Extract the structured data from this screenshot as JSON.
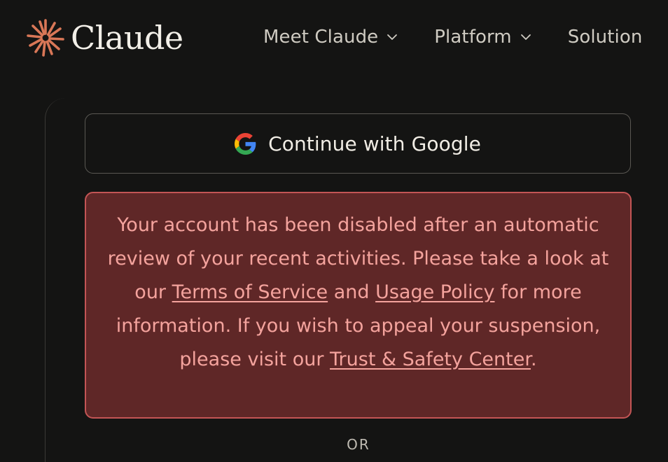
{
  "brand": {
    "name": "Claude",
    "accent_color": "#d97757"
  },
  "nav": {
    "items": [
      {
        "label": "Meet Claude"
      },
      {
        "label": "Platform"
      },
      {
        "label": "Solution"
      }
    ]
  },
  "login": {
    "google_button_label": "Continue with Google",
    "separator": "OR"
  },
  "alert": {
    "intro": "Your account has been disabled after an automatic review of your recent activities. Please take a look at our ",
    "terms_link": "Terms of Service",
    "and_text": " and ",
    "usage_link": "Usage Policy",
    "middle": " for more information. If you wish to appeal your suspension, please visit our ",
    "trust_link": "Trust & Safety Center",
    "end": ".",
    "background_color": "#5f2727",
    "border_color": "#c35555",
    "text_color": "#f4a39d"
  }
}
